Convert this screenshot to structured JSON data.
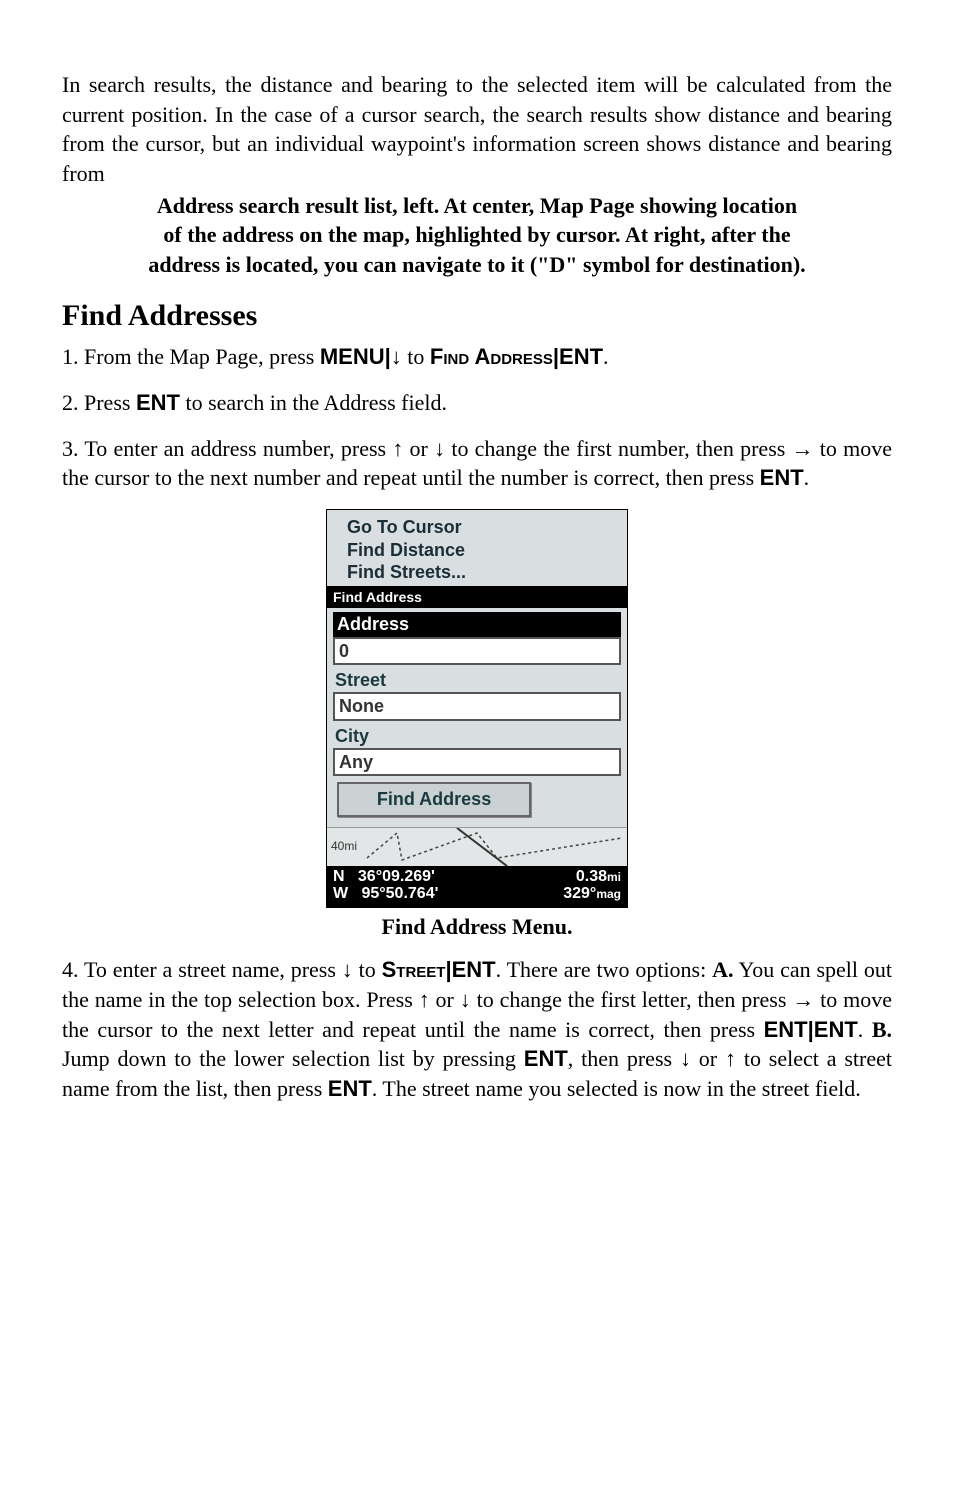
{
  "intro": "In search results, the distance and bearing to the selected item will be calculated from the current position. In the case of a cursor search, the search results show distance and bearing from the cursor, but an individual waypoint's information screen shows distance and bearing from",
  "caption_top_l1": "Address search result list, left. At center, Map Page showing location",
  "caption_top_l2": "of the address on the map, highlighted by cursor. At right, after the",
  "caption_top_l3": "address is located, you can navigate to it (\"D\" symbol for destination).",
  "heading": "Find Addresses",
  "step1": {
    "pre": "1. From the Map Page, press ",
    "menu": "MENU",
    "sep1": "|",
    "arrow_down": "↓",
    "to": " to ",
    "find_address": "Find Address",
    "sep2": "|",
    "ent": "ENT",
    "post": "."
  },
  "step2": {
    "pre": "2. Press ",
    "ent": "ENT",
    "post": " to search in the Address field."
  },
  "step3": {
    "pre": "3. To enter an address number, press ",
    "arrow_up": "↑",
    "or": " or ",
    "arrow_down": "↓",
    "mid": " to change the first number, then press ",
    "arrow_right": "→",
    "mid2": " to move the cursor to the next number and repeat until the number is correct, then press ",
    "ent": "ENT",
    "post": "."
  },
  "device": {
    "menu": {
      "l1": "Go To Cursor",
      "l2": "Find Distance",
      "l3": "Find Streets..."
    },
    "titlebar": "Find Address",
    "address_label": "Address",
    "address_value": "0",
    "street_label": "Street",
    "street_value": "None",
    "city_label": "City",
    "city_value": "Any",
    "find_button": "Find Address",
    "map_scale": "40mi",
    "coords": {
      "n_label": "N",
      "n_value": "36°09.269'",
      "w_label": "W",
      "w_value": "95°50.764'",
      "dist_value": "0.38",
      "dist_unit": "mi",
      "bearing_value": "329",
      "bearing_deg": "°",
      "bearing_unit": "mag"
    }
  },
  "fig_caption": "Find Address Menu.",
  "step4": {
    "pre": "4. To enter a street name, press ",
    "arrow_down": "↓",
    "to": " to ",
    "street": "Street",
    "sep": "|",
    "ent1": "ENT",
    "post1": ". There are two options: ",
    "A": "A.",
    "a_text": " You can spell out the name in the top selection box. Press ",
    "arrow_up": "↑",
    "or": " or ",
    "arrow_down2": "↓",
    "a_text2": " to change the first letter, then press ",
    "arrow_right": "→",
    "a_text3": " to move the cursor to the next letter and repeat until the name is correct, then press ",
    "ent2": "ENT",
    "sep2": "|",
    "ent3": "ENT",
    "a_text4": ". ",
    "B": "B.",
    "b_text": " Jump down to the lower selection list by pressing ",
    "ent4": "ENT",
    "b_text2": ", then press ",
    "arrow_down3": "↓",
    "or2": " or ",
    "arrow_up2": "↑",
    "b_text3": " to select a street name from the list, then press ",
    "ent5": "ENT",
    "b_text4": ". The street name you selected is now in the street field."
  }
}
